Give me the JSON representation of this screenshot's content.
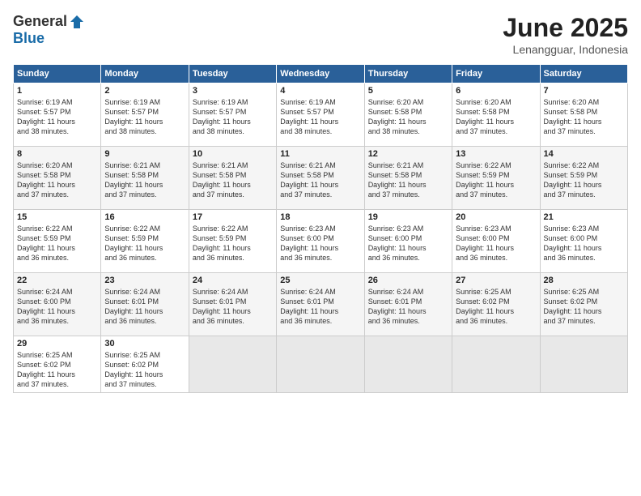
{
  "logo": {
    "general": "General",
    "blue": "Blue"
  },
  "title": "June 2025",
  "subtitle": "Lenangguar, Indonesia",
  "days_of_week": [
    "Sunday",
    "Monday",
    "Tuesday",
    "Wednesday",
    "Thursday",
    "Friday",
    "Saturday"
  ],
  "weeks": [
    [
      {
        "day": "1",
        "sunrise": "6:19 AM",
        "sunset": "5:57 PM",
        "daylight": "11 hours and 38 minutes."
      },
      {
        "day": "2",
        "sunrise": "6:19 AM",
        "sunset": "5:57 PM",
        "daylight": "11 hours and 38 minutes."
      },
      {
        "day": "3",
        "sunrise": "6:19 AM",
        "sunset": "5:57 PM",
        "daylight": "11 hours and 38 minutes."
      },
      {
        "day": "4",
        "sunrise": "6:19 AM",
        "sunset": "5:57 PM",
        "daylight": "11 hours and 38 minutes."
      },
      {
        "day": "5",
        "sunrise": "6:20 AM",
        "sunset": "5:58 PM",
        "daylight": "11 hours and 38 minutes."
      },
      {
        "day": "6",
        "sunrise": "6:20 AM",
        "sunset": "5:58 PM",
        "daylight": "11 hours and 37 minutes."
      },
      {
        "day": "7",
        "sunrise": "6:20 AM",
        "sunset": "5:58 PM",
        "daylight": "11 hours and 37 minutes."
      }
    ],
    [
      {
        "day": "8",
        "sunrise": "6:20 AM",
        "sunset": "5:58 PM",
        "daylight": "11 hours and 37 minutes."
      },
      {
        "day": "9",
        "sunrise": "6:21 AM",
        "sunset": "5:58 PM",
        "daylight": "11 hours and 37 minutes."
      },
      {
        "day": "10",
        "sunrise": "6:21 AM",
        "sunset": "5:58 PM",
        "daylight": "11 hours and 37 minutes."
      },
      {
        "day": "11",
        "sunrise": "6:21 AM",
        "sunset": "5:58 PM",
        "daylight": "11 hours and 37 minutes."
      },
      {
        "day": "12",
        "sunrise": "6:21 AM",
        "sunset": "5:58 PM",
        "daylight": "11 hours and 37 minutes."
      },
      {
        "day": "13",
        "sunrise": "6:22 AM",
        "sunset": "5:59 PM",
        "daylight": "11 hours and 37 minutes."
      },
      {
        "day": "14",
        "sunrise": "6:22 AM",
        "sunset": "5:59 PM",
        "daylight": "11 hours and 37 minutes."
      }
    ],
    [
      {
        "day": "15",
        "sunrise": "6:22 AM",
        "sunset": "5:59 PM",
        "daylight": "11 hours and 36 minutes."
      },
      {
        "day": "16",
        "sunrise": "6:22 AM",
        "sunset": "5:59 PM",
        "daylight": "11 hours and 36 minutes."
      },
      {
        "day": "17",
        "sunrise": "6:22 AM",
        "sunset": "5:59 PM",
        "daylight": "11 hours and 36 minutes."
      },
      {
        "day": "18",
        "sunrise": "6:23 AM",
        "sunset": "6:00 PM",
        "daylight": "11 hours and 36 minutes."
      },
      {
        "day": "19",
        "sunrise": "6:23 AM",
        "sunset": "6:00 PM",
        "daylight": "11 hours and 36 minutes."
      },
      {
        "day": "20",
        "sunrise": "6:23 AM",
        "sunset": "6:00 PM",
        "daylight": "11 hours and 36 minutes."
      },
      {
        "day": "21",
        "sunrise": "6:23 AM",
        "sunset": "6:00 PM",
        "daylight": "11 hours and 36 minutes."
      }
    ],
    [
      {
        "day": "22",
        "sunrise": "6:24 AM",
        "sunset": "6:00 PM",
        "daylight": "11 hours and 36 minutes."
      },
      {
        "day": "23",
        "sunrise": "6:24 AM",
        "sunset": "6:01 PM",
        "daylight": "11 hours and 36 minutes."
      },
      {
        "day": "24",
        "sunrise": "6:24 AM",
        "sunset": "6:01 PM",
        "daylight": "11 hours and 36 minutes."
      },
      {
        "day": "25",
        "sunrise": "6:24 AM",
        "sunset": "6:01 PM",
        "daylight": "11 hours and 36 minutes."
      },
      {
        "day": "26",
        "sunrise": "6:24 AM",
        "sunset": "6:01 PM",
        "daylight": "11 hours and 36 minutes."
      },
      {
        "day": "27",
        "sunrise": "6:25 AM",
        "sunset": "6:02 PM",
        "daylight": "11 hours and 36 minutes."
      },
      {
        "day": "28",
        "sunrise": "6:25 AM",
        "sunset": "6:02 PM",
        "daylight": "11 hours and 37 minutes."
      }
    ],
    [
      {
        "day": "29",
        "sunrise": "6:25 AM",
        "sunset": "6:02 PM",
        "daylight": "11 hours and 37 minutes."
      },
      {
        "day": "30",
        "sunrise": "6:25 AM",
        "sunset": "6:02 PM",
        "daylight": "11 hours and 37 minutes."
      },
      null,
      null,
      null,
      null,
      null
    ]
  ],
  "labels": {
    "sunrise": "Sunrise:",
    "sunset": "Sunset:",
    "daylight": "Daylight:"
  }
}
